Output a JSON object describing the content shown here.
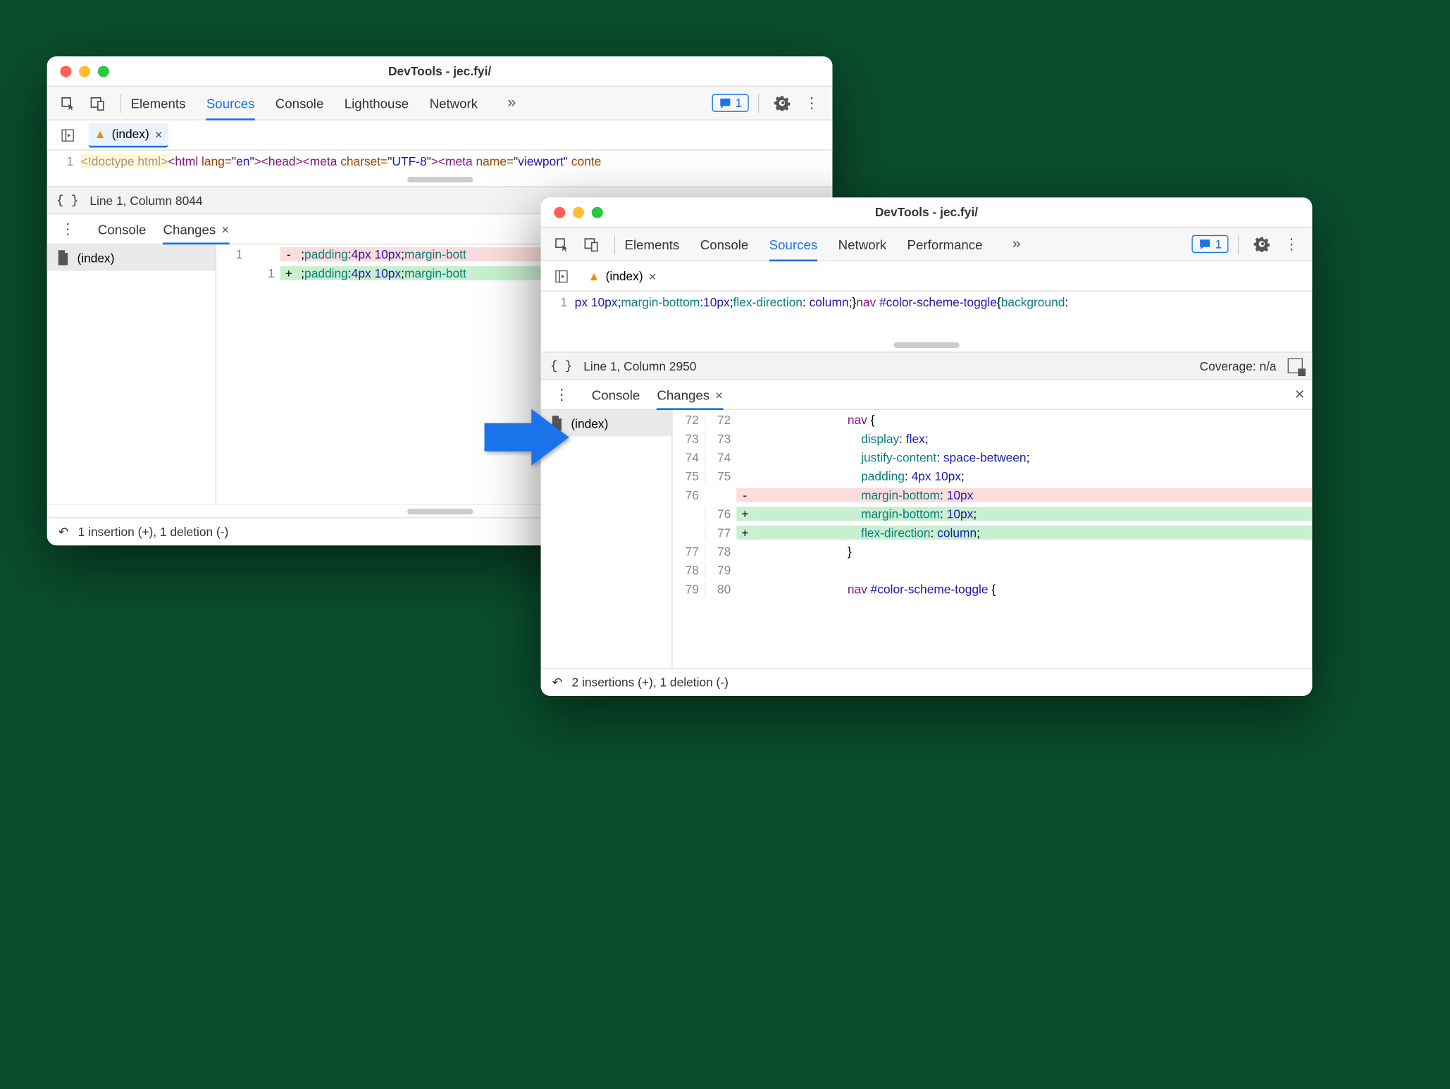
{
  "window1": {
    "title": "DevTools - jec.fyi/",
    "tabs": [
      "Elements",
      "Sources",
      "Console",
      "Lighthouse",
      "Network"
    ],
    "active_tab": "Sources",
    "issues": "1",
    "file_tab": "(index)",
    "line_num": "1",
    "code": {
      "doctype": "<!doctype html>",
      "html_open": "<html ",
      "lang_attr": "lang=",
      "lang_val": "\"en\"",
      "head": "><head><meta ",
      "charset_attr": "charset=",
      "charset_val": "\"UTF-8\"",
      "meta2": "><meta ",
      "name_attr": "name=",
      "name_val": "\"viewport\"",
      "trail": " conte"
    },
    "status": "Line 1, Column 8044",
    "drawer_tabs": [
      "Console",
      "Changes"
    ],
    "drawer_active": "Changes",
    "file_list": "(index)",
    "diff": {
      "old": "1",
      "new": "1",
      "del_sign": "-",
      "add_sign": "+",
      "del_text_a": ";",
      "del_prop": "padding",
      "del_text_b": ":",
      "del_v1": "4px",
      "del_text_c": " ",
      "del_v2": "10px",
      "del_text_d": ";",
      "del_prop2": "margin-bott",
      "add_text_a": ";",
      "add_prop": "padding",
      "add_text_b": ":",
      "add_v1": "4px",
      "add_text_c": " ",
      "add_v2": "10px",
      "add_text_d": ";",
      "add_prop2": "margin-bott"
    },
    "footer": "1 insertion (+), 1 deletion (-)"
  },
  "window2": {
    "title": "DevTools - jec.fyi/",
    "tabs": [
      "Elements",
      "Console",
      "Sources",
      "Network",
      "Performance"
    ],
    "active_tab": "Sources",
    "issues": "1",
    "file_tab": "(index)",
    "line_num": "1",
    "code": {
      "a": "px ",
      "n1": "10px",
      "b": ";",
      "p1": "margin-bottom",
      "c": ":",
      "n2": "10px",
      "d": ";",
      "p2": "flex-direction",
      "e": ": ",
      "kw": "column",
      "f": ";}",
      "sel": "nav ",
      "id": "#color-scheme-toggle",
      "g": "{",
      "p3": "background",
      "h": ":"
    },
    "status": "Line 1, Column 2950",
    "coverage": "Coverage: n/a",
    "drawer_tabs": [
      "Console",
      "Changes"
    ],
    "drawer_active": "Changes",
    "file_list": "(index)",
    "diff_rows": [
      {
        "l": "72",
        "r": "72",
        "s": "",
        "t": [
          {
            "k": "sel",
            "v": "nav"
          },
          {
            "k": "",
            "v": " {"
          }
        ]
      },
      {
        "l": "73",
        "r": "73",
        "s": "",
        "t": [
          {
            "k": "",
            "v": "    "
          },
          {
            "k": "prop",
            "v": "display"
          },
          {
            "k": "",
            "v": ": "
          },
          {
            "k": "kw",
            "v": "flex"
          },
          {
            "k": "",
            "v": ";"
          }
        ]
      },
      {
        "l": "74",
        "r": "74",
        "s": "",
        "t": [
          {
            "k": "",
            "v": "    "
          },
          {
            "k": "prop",
            "v": "justify-content"
          },
          {
            "k": "",
            "v": ": "
          },
          {
            "k": "kw",
            "v": "space-between"
          },
          {
            "k": "",
            "v": ";"
          }
        ]
      },
      {
        "l": "75",
        "r": "75",
        "s": "",
        "t": [
          {
            "k": "",
            "v": "    "
          },
          {
            "k": "prop",
            "v": "padding"
          },
          {
            "k": "",
            "v": ": "
          },
          {
            "k": "num",
            "v": "4px 10px"
          },
          {
            "k": "",
            "v": ";"
          }
        ]
      },
      {
        "l": "76",
        "r": "",
        "s": "-",
        "cls": "del",
        "t": [
          {
            "k": "",
            "v": "    "
          },
          {
            "k": "prop",
            "v": "margin-bottom"
          },
          {
            "k": "",
            "v": ": "
          },
          {
            "k": "num",
            "v": "10px"
          }
        ]
      },
      {
        "l": "",
        "r": "76",
        "s": "+",
        "cls": "add",
        "t": [
          {
            "k": "",
            "v": "    "
          },
          {
            "k": "prop",
            "v": "margin-bottom"
          },
          {
            "k": "",
            "v": ": "
          },
          {
            "k": "num",
            "v": "10px"
          },
          {
            "k": "",
            "v": ";"
          }
        ]
      },
      {
        "l": "",
        "r": "77",
        "s": "+",
        "cls": "add",
        "t": [
          {
            "k": "",
            "v": "    "
          },
          {
            "k": "prop",
            "v": "flex-direction"
          },
          {
            "k": "",
            "v": ": "
          },
          {
            "k": "kw",
            "v": "column"
          },
          {
            "k": "",
            "v": ";"
          }
        ]
      },
      {
        "l": "77",
        "r": "78",
        "s": "",
        "t": [
          {
            "k": "",
            "v": "}"
          }
        ]
      },
      {
        "l": "78",
        "r": "79",
        "s": "",
        "t": []
      },
      {
        "l": "79",
        "r": "80",
        "s": "",
        "t": [
          {
            "k": "sel",
            "v": "nav "
          },
          {
            "k": "id",
            "v": "#color-scheme-toggle"
          },
          {
            "k": "",
            "v": " {"
          }
        ]
      }
    ],
    "footer": "2 insertions (+), 1 deletion (-)"
  }
}
